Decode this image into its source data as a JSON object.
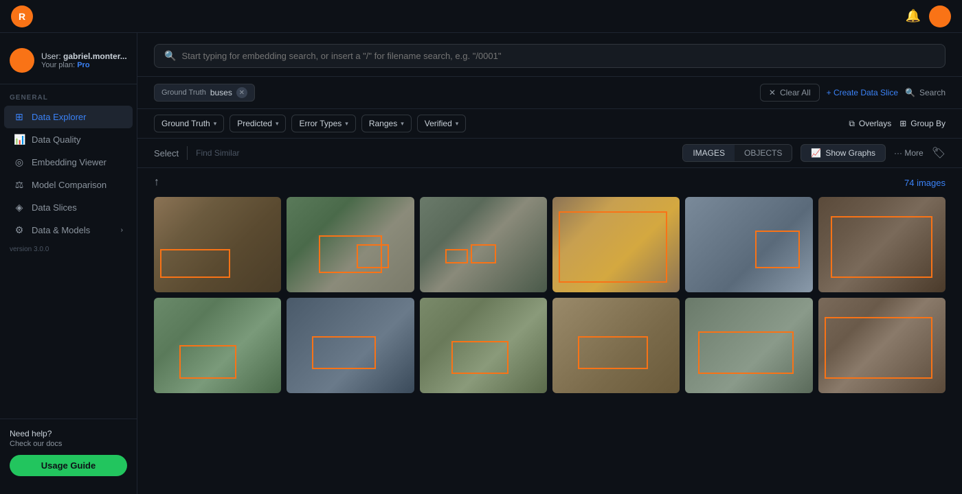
{
  "app": {
    "title": "Data Explorer",
    "logo": "R",
    "version": "version 3.0.0"
  },
  "topbar": {
    "bell_label": "🔔",
    "avatar_label": ""
  },
  "sidebar": {
    "user": {
      "name_label": "User:",
      "name_value": "gabriel.monter...",
      "plan_label": "Your plan:",
      "plan_value": "Pro"
    },
    "section_label": "GENERAL",
    "items": [
      {
        "label": "Data Explorer",
        "icon": "⊞",
        "active": true
      },
      {
        "label": "Data Quality",
        "icon": "📊",
        "active": false
      },
      {
        "label": "Embedding Viewer",
        "icon": "◎",
        "active": false
      },
      {
        "label": "Model Comparison",
        "icon": "⚖",
        "active": false
      },
      {
        "label": "Data Slices",
        "icon": "◈",
        "active": false
      },
      {
        "label": "Data & Models",
        "icon": "⚙",
        "active": false,
        "arrow": "›"
      }
    ],
    "footer": {
      "help_label": "Need help?",
      "docs_label": "Check our docs",
      "usage_btn": "Usage Guide"
    }
  },
  "search": {
    "placeholder": "Start typing for embedding search, or insert a \"/\" for filename search, e.g. \"/0001\""
  },
  "filter_bar": {
    "chip_label": "Ground Truth",
    "chip_value": "buses",
    "clear_btn": "Clear All",
    "create_btn": "+ Create Data Slice",
    "search_btn": "Search"
  },
  "dropdowns": {
    "ground_truth": "Ground Truth",
    "predicted": "Predicted",
    "error_types": "Error Types",
    "ranges": "Ranges",
    "verified": "Verified",
    "overlays": "Overlays",
    "group_by": "Group By"
  },
  "toolbar": {
    "select_label": "Select",
    "find_similar_label": "Find Similar",
    "tab_images": "IMAGES",
    "tab_objects": "OBJECTS",
    "show_graphs": "Show Graphs",
    "more_label": "··· More"
  },
  "content": {
    "image_count": "74 images",
    "images": [
      {
        "id": 1,
        "cls": "img-1"
      },
      {
        "id": 2,
        "cls": "img-2"
      },
      {
        "id": 3,
        "cls": "img-3"
      },
      {
        "id": 4,
        "cls": "img-4"
      },
      {
        "id": 5,
        "cls": "img-5"
      },
      {
        "id": 6,
        "cls": "img-6"
      },
      {
        "id": 7,
        "cls": "img-7"
      },
      {
        "id": 8,
        "cls": "img-8"
      },
      {
        "id": 9,
        "cls": "img-9"
      },
      {
        "id": 10,
        "cls": "img-10"
      },
      {
        "id": 11,
        "cls": "img-11"
      },
      {
        "id": 12,
        "cls": "img-12"
      }
    ]
  }
}
